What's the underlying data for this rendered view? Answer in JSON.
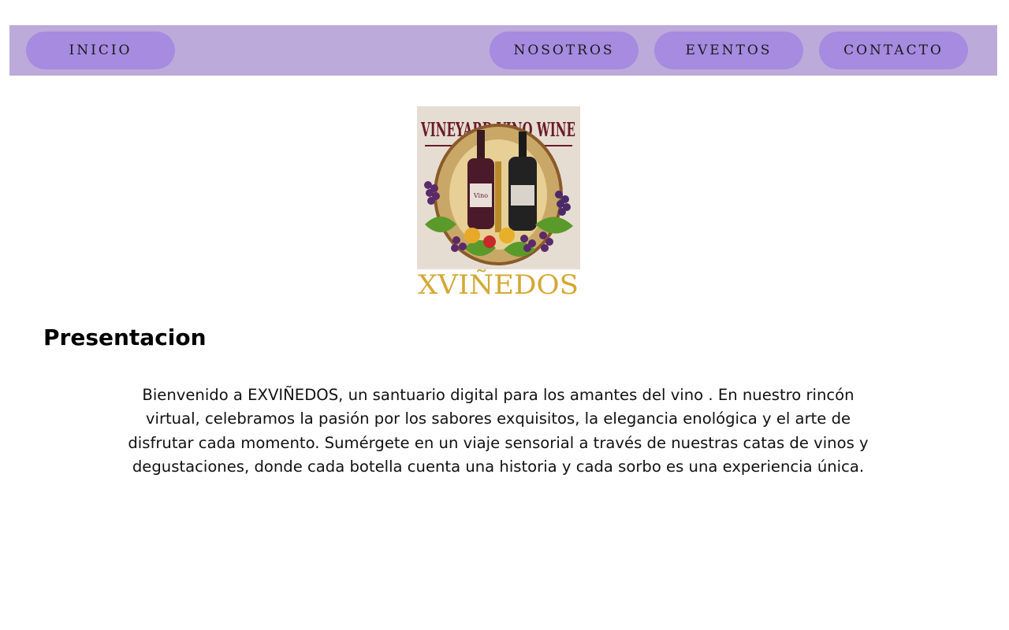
{
  "nav": {
    "inicio": "INICIO",
    "nosotros": "NOSOTROS",
    "eventos": "EVENTOS",
    "contacto": "CONTACTO"
  },
  "logo": {
    "arch_text": "VINEYARD VINO WINE",
    "bottom_text": "XVIÑEDOS",
    "bottle_label": "Vino"
  },
  "main": {
    "title": "Presentacion",
    "text": "Bienvenido a EXVIÑEDOS, un santuario digital para los amantes del vino . En nuestro rincón virtual, celebramos la pasión por los sabores exquisitos, la elegancia enológica y el arte de disfrutar cada momento. Sumérgete en un viaje sensorial a través de nuestras catas de vinos y degustaciones, donde cada botella cuenta una historia y cada sorbo es una experiencia única."
  },
  "colors": {
    "navbar_bg": "#bcaadb",
    "nav_button_bg": "#a68be0",
    "logo_gold": "#d4a933",
    "logo_wine": "#6a1a2a"
  }
}
